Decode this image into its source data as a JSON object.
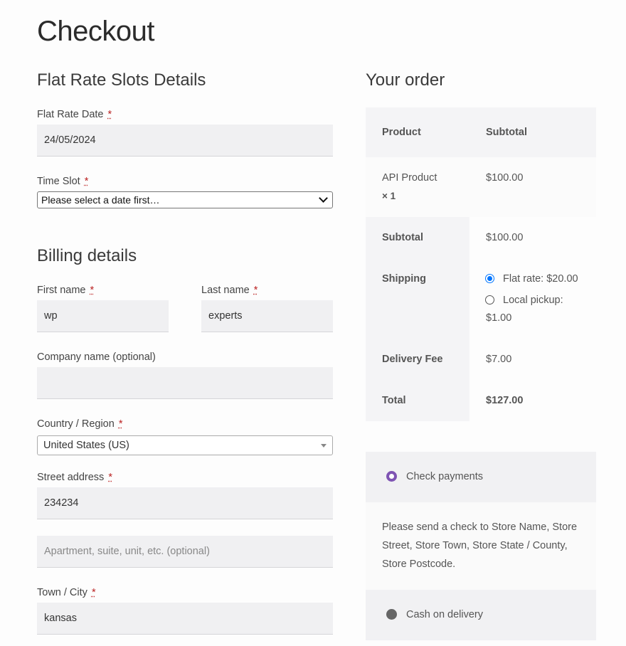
{
  "page": {
    "title": "Checkout"
  },
  "slots": {
    "title": "Flat Rate Slots Details",
    "date_label": "Flat Rate Date ",
    "date_value": "24/05/2024",
    "time_label": "Time Slot ",
    "time_value": "Please select a date first…"
  },
  "billing": {
    "title": "Billing details",
    "first_name_label": "First name ",
    "first_name_value": "wp",
    "last_name_label": "Last name ",
    "last_name_value": "experts",
    "company_label": "Company name (optional)",
    "company_value": "",
    "country_label": "Country / Region ",
    "country_value": "United States (US)",
    "street_label": "Street address ",
    "street_value": "234234",
    "apartment_placeholder": "Apartment, suite, unit, etc. (optional)",
    "town_label": "Town / City ",
    "town_value": "kansas",
    "required_mark": "*"
  },
  "order": {
    "title": "Your order",
    "col_product": "Product",
    "col_subtotal": "Subtotal",
    "item_name": "API Product",
    "item_qty": "× 1",
    "item_price": "$100.00",
    "subtotal_label": "Subtotal",
    "subtotal_value": "$100.00",
    "shipping_label": "Shipping",
    "shipping_options": [
      {
        "label": "Flat rate: $20.00",
        "checked": true
      },
      {
        "label": "Local pickup:",
        "sub": "$1.00",
        "checked": false
      }
    ],
    "fee_label": "Delivery Fee",
    "fee_value": "$7.00",
    "total_label": "Total",
    "total_value": "$127.00"
  },
  "payment": {
    "methods": [
      {
        "label": "Check payments",
        "checked": true
      },
      {
        "label": "Cash on delivery",
        "checked": false
      }
    ],
    "check_description_lines": [
      "Please send a check to Store Name, Store",
      "Street, Store Town, Store State / County,",
      "Store Postcode."
    ]
  },
  "colors": {
    "accent": "#7f54b3",
    "radio_blue": "#0075ff",
    "required": "#b22222"
  }
}
